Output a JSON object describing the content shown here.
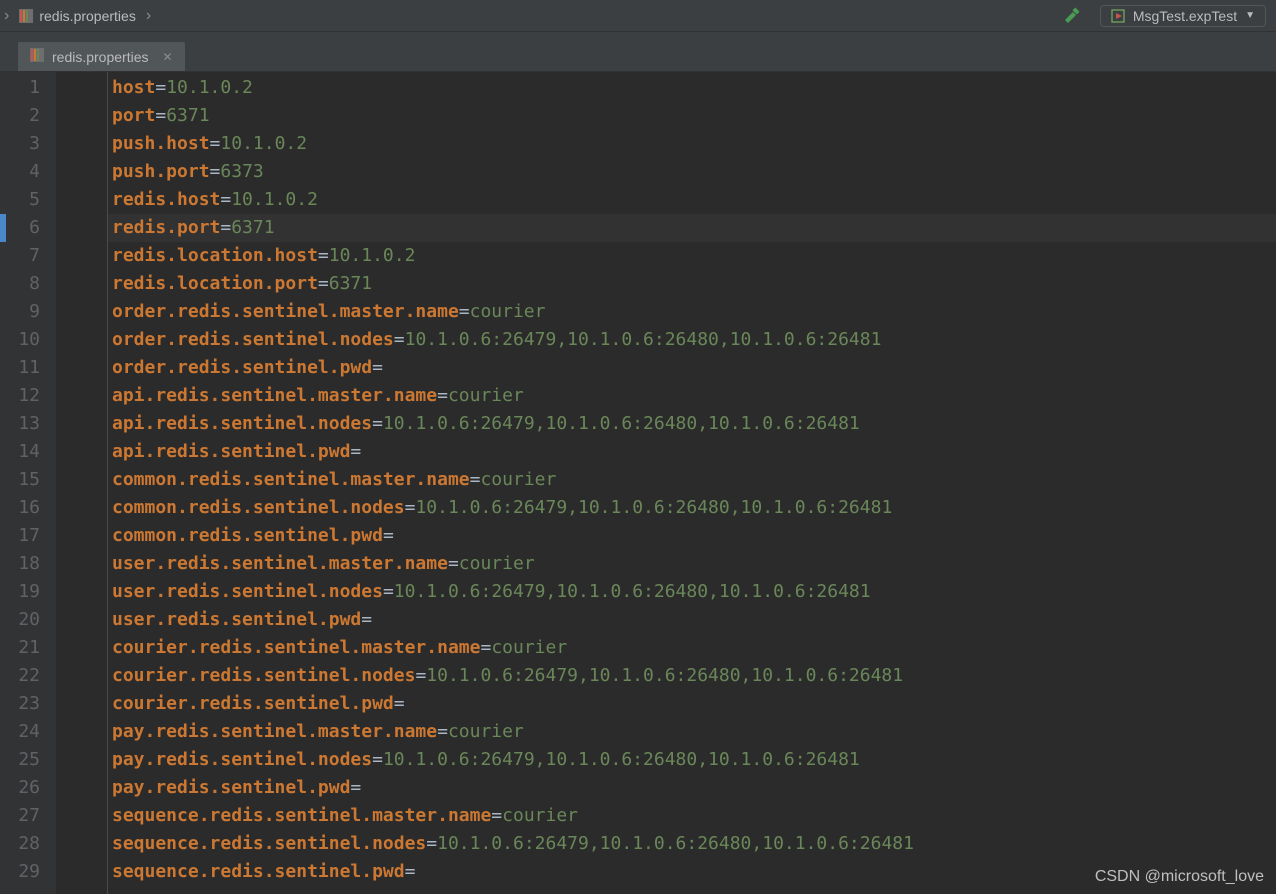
{
  "breadcrumb": {
    "file": "redis.properties"
  },
  "run_config": {
    "label": "MsgTest.expTest"
  },
  "tab": {
    "file": "redis.properties"
  },
  "active_line": 6,
  "lines": [
    {
      "k": "host",
      "v": "10.1.0.2"
    },
    {
      "k": "port",
      "v": "6371"
    },
    {
      "k": "push.host",
      "v": "10.1.0.2"
    },
    {
      "k": "push.port",
      "v": "6373"
    },
    {
      "k": "redis.host",
      "v": "10.1.0.2"
    },
    {
      "k": "redis.port",
      "v": "6371"
    },
    {
      "k": "redis.location.host",
      "v": "10.1.0.2"
    },
    {
      "k": "redis.location.port",
      "v": "6371"
    },
    {
      "k": "order.redis.sentinel.master.name",
      "v": "courier"
    },
    {
      "k": "order.redis.sentinel.nodes",
      "v": "10.1.0.6:26479,10.1.0.6:26480,10.1.0.6:26481"
    },
    {
      "k": "order.redis.sentinel.pwd",
      "v": ""
    },
    {
      "k": "api.redis.sentinel.master.name",
      "v": "courier"
    },
    {
      "k": "api.redis.sentinel.nodes",
      "v": "10.1.0.6:26479,10.1.0.6:26480,10.1.0.6:26481"
    },
    {
      "k": "api.redis.sentinel.pwd",
      "v": ""
    },
    {
      "k": "common.redis.sentinel.master.name",
      "v": "courier"
    },
    {
      "k": "common.redis.sentinel.nodes",
      "v": "10.1.0.6:26479,10.1.0.6:26480,10.1.0.6:26481"
    },
    {
      "k": "common.redis.sentinel.pwd",
      "v": ""
    },
    {
      "k": "user.redis.sentinel.master.name",
      "v": "courier"
    },
    {
      "k": "user.redis.sentinel.nodes",
      "v": "10.1.0.6:26479,10.1.0.6:26480,10.1.0.6:26481"
    },
    {
      "k": "user.redis.sentinel.pwd",
      "v": ""
    },
    {
      "k": "courier.redis.sentinel.master.name",
      "v": "courier"
    },
    {
      "k": "courier.redis.sentinel.nodes",
      "v": "10.1.0.6:26479,10.1.0.6:26480,10.1.0.6:26481"
    },
    {
      "k": "courier.redis.sentinel.pwd",
      "v": ""
    },
    {
      "k": "pay.redis.sentinel.master.name",
      "v": "courier"
    },
    {
      "k": "pay.redis.sentinel.nodes",
      "v": "10.1.0.6:26479,10.1.0.6:26480,10.1.0.6:26481"
    },
    {
      "k": "pay.redis.sentinel.pwd",
      "v": ""
    },
    {
      "k": "sequence.redis.sentinel.master.name",
      "v": "courier"
    },
    {
      "k": "sequence.redis.sentinel.nodes",
      "v": "10.1.0.6:26479,10.1.0.6:26480,10.1.0.6:26481"
    },
    {
      "k": "sequence.redis.sentinel.pwd",
      "v": ""
    }
  ],
  "watermark": "CSDN @microsoft_love"
}
